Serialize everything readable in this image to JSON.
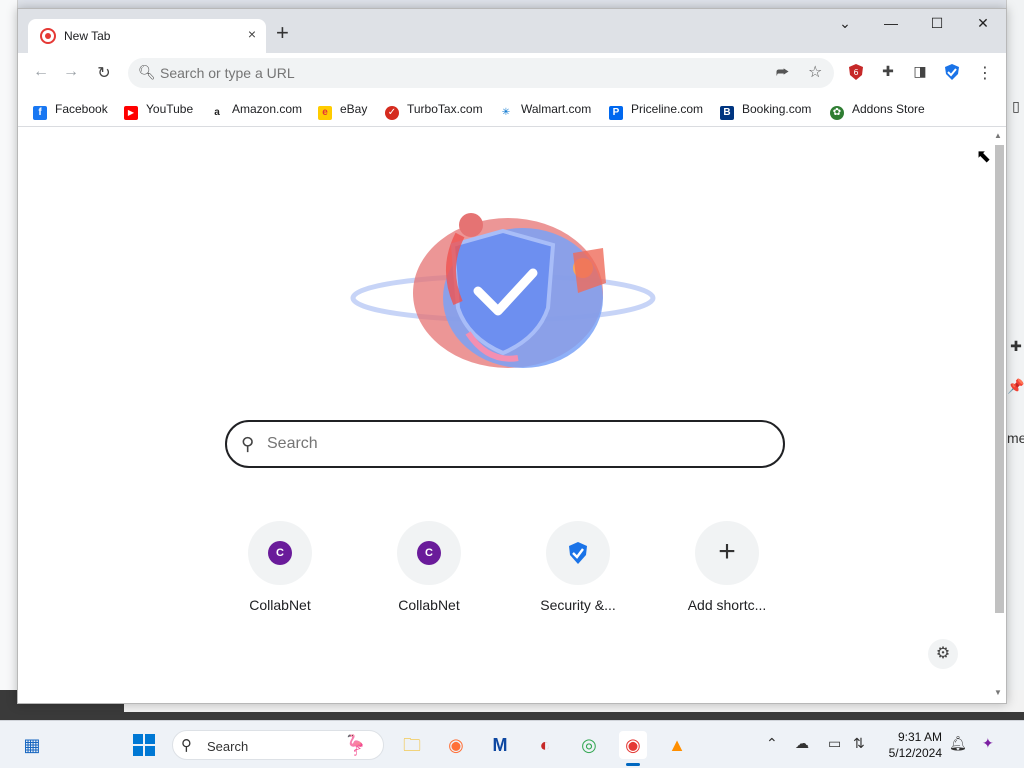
{
  "browser": {
    "tab": {
      "title": "New Tab",
      "close_icon": "×"
    },
    "new_tab_icon": "+",
    "window_controls": {
      "dropdown": "⌄",
      "minimize": "—",
      "maximize": "☐",
      "close": "✕"
    },
    "nav": {
      "back": "←",
      "forward": "→",
      "reload": "↻"
    },
    "omnibox": {
      "placeholder": "Search or type a URL",
      "share_icon": "⮫",
      "star_icon": "☆"
    },
    "menu_icon": "⋮",
    "bookmarks": [
      {
        "label": "Facebook",
        "icon": "f",
        "color": "#1877f2"
      },
      {
        "label": "YouTube",
        "icon": "▶",
        "color": "#ff0000"
      },
      {
        "label": "Amazon.com",
        "icon": "a",
        "color": "#222222"
      },
      {
        "label": "eBay",
        "icon": "e",
        "color": "#e53238"
      },
      {
        "label": "TurboTax.com",
        "icon": "✓",
        "color": "#d52b1e"
      },
      {
        "label": "Walmart.com",
        "icon": "✳",
        "color": "#0071ce"
      },
      {
        "label": "Priceline.com",
        "icon": "P",
        "color": "#0068ef"
      },
      {
        "label": "Booking.com",
        "icon": "B",
        "color": "#003580"
      },
      {
        "label": "Addons Store",
        "icon": "✿",
        "color": "#2e7d32"
      }
    ]
  },
  "newtab": {
    "search_placeholder": "Search",
    "shortcuts": [
      {
        "label": "CollabNet",
        "icon": "C"
      },
      {
        "label": "CollabNet",
        "icon": "C"
      },
      {
        "label": "Security &...",
        "icon": "shield"
      },
      {
        "label": "Add shortc...",
        "icon": "+"
      }
    ],
    "customize_icon": "⚙"
  },
  "taskbar": {
    "search_label": "Search",
    "clock_time": "9:31 AM",
    "clock_date": "5/12/2024"
  }
}
